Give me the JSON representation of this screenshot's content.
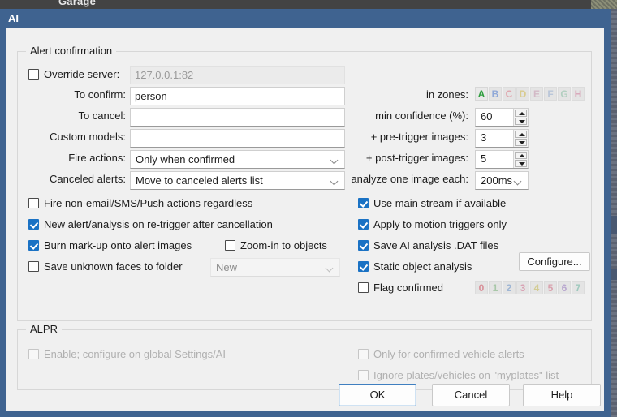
{
  "background": {
    "tab_label": "Garage"
  },
  "window": {
    "title": "AI"
  },
  "groups": {
    "alert": {
      "legend": "Alert confirmation"
    },
    "alpr": {
      "legend": "ALPR"
    }
  },
  "alert_confirmation": {
    "override_server": {
      "label": "Override server:",
      "checked": false,
      "value": "127.0.0.1:82",
      "enabled": false
    },
    "to_confirm": {
      "label": "To confirm:",
      "value": "person"
    },
    "to_cancel": {
      "label": "To cancel:",
      "value": ""
    },
    "custom_models": {
      "label": "Custom models:",
      "value": ""
    },
    "fire_actions": {
      "label": "Fire actions:",
      "value": "Only when confirmed"
    },
    "canceled_alerts": {
      "label": "Canceled alerts:",
      "value": "Move to canceled alerts list"
    },
    "in_zones": {
      "label": "in zones:",
      "zones": [
        {
          "letter": "A",
          "color": "#2f9e3f",
          "active": true
        },
        {
          "letter": "B",
          "color": "#8fa8d8",
          "active": false
        },
        {
          "letter": "C",
          "color": "#e0a5ad",
          "active": false
        },
        {
          "letter": "D",
          "color": "#d9cb8e",
          "active": false
        },
        {
          "letter": "E",
          "color": "#d3b9c6",
          "active": false
        },
        {
          "letter": "F",
          "color": "#b9c6d9",
          "active": false
        },
        {
          "letter": "G",
          "color": "#b2cfc0",
          "active": false
        },
        {
          "letter": "H",
          "color": "#d9a9bb",
          "active": false
        }
      ]
    },
    "min_confidence": {
      "label": "min confidence (%):",
      "value": "60"
    },
    "pre_trigger_images": {
      "label": "+ pre-trigger images:",
      "value": "3"
    },
    "post_trigger_images": {
      "label": "+ post-trigger images:",
      "value": "5"
    },
    "analyze_interval": {
      "label": "analyze one image each:",
      "value": "200ms"
    },
    "checkboxes": {
      "fire_non_email": {
        "label": "Fire non-email/SMS/Push actions regardless",
        "checked": false,
        "enabled": true
      },
      "new_alert_retrigger": {
        "label": "New alert/analysis on re-trigger after cancellation",
        "checked": true,
        "enabled": true
      },
      "burn_markup": {
        "label": "Burn mark-up onto alert images",
        "checked": true,
        "enabled": true
      },
      "zoom_in_objects": {
        "label": "Zoom-in to objects",
        "checked": false,
        "enabled": true
      },
      "save_unknown_faces": {
        "label": "Save unknown faces to folder",
        "checked": false,
        "enabled": true
      },
      "use_main_stream": {
        "label": "Use main stream if available",
        "checked": true,
        "enabled": true
      },
      "apply_motion_only": {
        "label": "Apply to motion triggers only",
        "checked": true,
        "enabled": true
      },
      "save_dat_files": {
        "label": "Save AI analysis .DAT files",
        "checked": true,
        "enabled": true
      },
      "static_object_analysis": {
        "label": "Static object analysis",
        "checked": true,
        "enabled": true
      },
      "flag_confirmed": {
        "label": "Flag confirmed",
        "checked": false,
        "enabled": true
      }
    },
    "unknown_faces_folder": {
      "value": "New",
      "enabled": false
    },
    "configure_button": {
      "label": "Configure..."
    },
    "flags": [
      {
        "digit": "0",
        "color": "#d88f98"
      },
      {
        "digit": "1",
        "color": "#a8c7a8"
      },
      {
        "digit": "2",
        "color": "#9fb6d4"
      },
      {
        "digit": "3",
        "color": "#d9a2b4"
      },
      {
        "digit": "4",
        "color": "#d3cc94"
      },
      {
        "digit": "5",
        "color": "#d9a2ae"
      },
      {
        "digit": "6",
        "color": "#b9a8cf"
      },
      {
        "digit": "7",
        "color": "#9ec9bd"
      }
    ]
  },
  "alpr": {
    "enable": {
      "label": "Enable; configure on global Settings/AI",
      "checked": false,
      "enabled": false
    },
    "only_confirmed": {
      "label": "Only for confirmed vehicle alerts",
      "checked": false,
      "enabled": false
    },
    "ignore_plates": {
      "label": "Ignore plates/vehicles on \"myplates\" list",
      "checked": false,
      "enabled": false
    }
  },
  "buttons": {
    "ok": "OK",
    "cancel": "Cancel",
    "help": "Help"
  },
  "colors": {
    "titlebar": "#3f6390",
    "dialog_bg": "#f0f0f0",
    "checkbox_checked": "#1a72c4",
    "default_button_border": "#3f7fc0"
  }
}
